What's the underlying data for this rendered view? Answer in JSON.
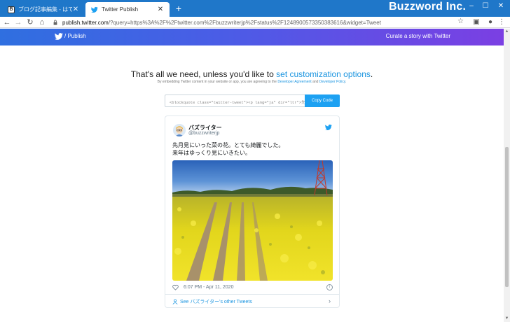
{
  "browser": {
    "tabs": [
      {
        "label": "ブログ記事編集 - はてなブログ",
        "icon": "hatena-icon",
        "active": false
      },
      {
        "label": "Twitter Publish",
        "icon": "twitter-bird-icon",
        "active": true
      }
    ],
    "new_tab_symbol": "+",
    "brand_overlay": "Buzzword Inc.",
    "url_host": "publish.twitter.com",
    "url_rest": "/?query=https%3A%2F%2Ftwitter.com%2Fbuzzwriterjp%2Fstatus%2F1248900573350383616&widget=Tweet"
  },
  "banner": {
    "brand_suffix": "/ Publish",
    "right_link": "Curate a story with Twitter",
    "gradient": [
      "#2f6fe0",
      "#7b3fe3"
    ]
  },
  "main": {
    "headline_prefix": "That's all we need, unless you'd like to",
    "headline_link": "set customization options",
    "headline_suffix": ".",
    "sub_prefix": "By embedding Twitter content in your website or app, you are agreeing to the",
    "sub_link1": "Developer Agreement",
    "sub_and": "and",
    "sub_link2": "Developer Policy",
    "sub_suffix": ".",
    "embed_code": "<blockquote class=\"twitter-tweet\"><p lang=\"ja\" dir=\"ltr\">先月見にいった菜の花。",
    "copy_button": "Copy Code"
  },
  "tweet": {
    "display_name": "バズライター",
    "handle": "@buzzwriterjp",
    "text_line1": "先月見にいった菜の花。とても綺麗でした。",
    "text_line2": "来年はゆっくり見にいきたい。",
    "timestamp": "6:07 PM - Apr 11, 2020",
    "see_more": "See バズライター's other Tweets",
    "info_symbol": "i",
    "chevron": "›",
    "accent_color": "#1da1f2"
  }
}
